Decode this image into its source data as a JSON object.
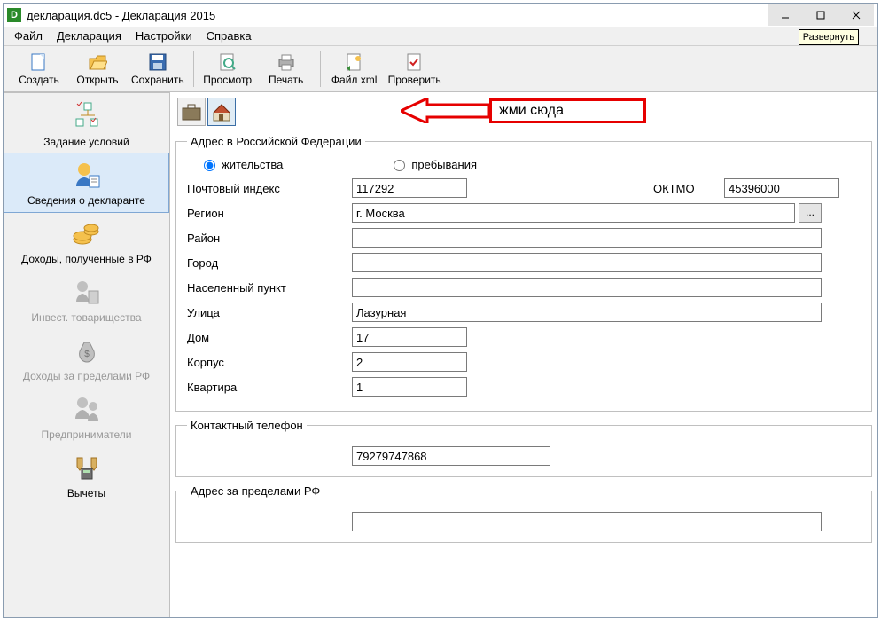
{
  "title": "декларация.dc5 - Декларация 2015",
  "sysbuttons_tooltip": "Развернуть",
  "menu": {
    "file": "Файл",
    "decl": "Декларация",
    "settings": "Настройки",
    "help": "Справка"
  },
  "toolbar": {
    "create": "Создать",
    "open": "Открыть",
    "save": "Сохранить",
    "preview": "Просмотр",
    "print": "Печать",
    "xml": "Файл xml",
    "check": "Проверить"
  },
  "side": {
    "task": "Задание условий",
    "declarant": "Сведения о декларанте",
    "income_rf": "Доходы, полученные в РФ",
    "invest": "Инвест. товарищества",
    "income_out": "Доходы за пределами РФ",
    "business": "Предприниматели",
    "deductions": "Вычеты"
  },
  "callout": "жми сюда",
  "groups": {
    "address_rf": "Адрес в Российской Федерации",
    "phone": "Контактный телефон",
    "address_out": "Адрес за пределами РФ"
  },
  "labels": {
    "residence": "жительства",
    "stay": "пребывания",
    "postindex": "Почтовый индекс",
    "oktmo": "ОКТМО",
    "region": "Регион",
    "district": "Район",
    "city": "Город",
    "settlement": "Населенный пункт",
    "street": "Улица",
    "house": "Дом",
    "building": "Корпус",
    "flat": "Квартира"
  },
  "values": {
    "postindex": "117292",
    "oktmo": "45396000",
    "region": "г. Москва",
    "district": "",
    "city": "",
    "settlement": "",
    "street": "Лазурная",
    "house": "17",
    "building": "2",
    "flat": "1",
    "phone": "79279747868",
    "address_out": ""
  }
}
